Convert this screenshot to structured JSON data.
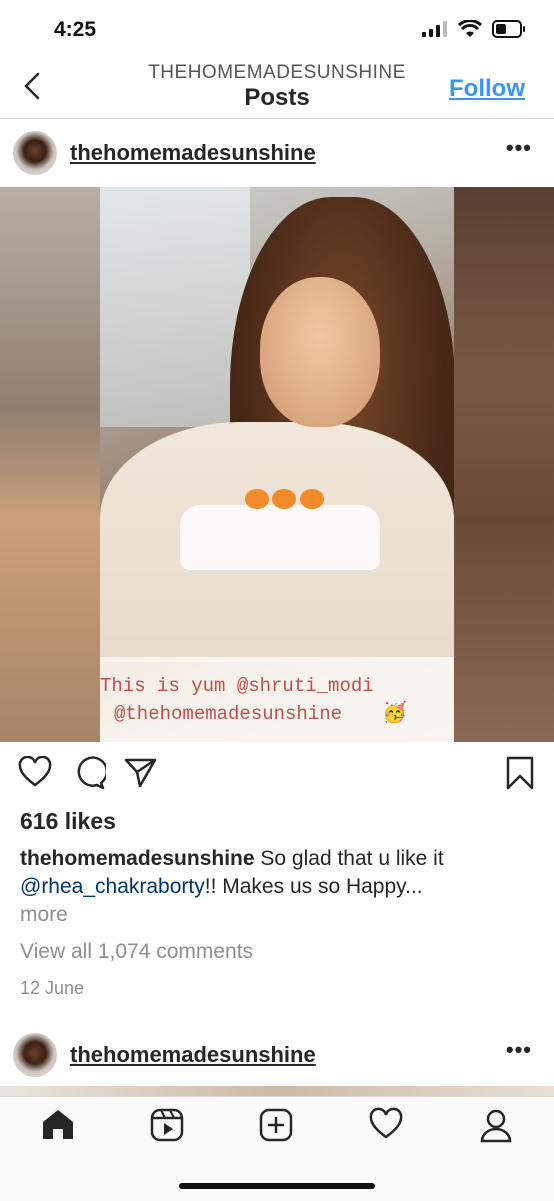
{
  "status": {
    "time": "4:25"
  },
  "header": {
    "subtitle": "THEHOMEMADESUNSHINE",
    "title": "Posts",
    "follow_label": "Follow"
  },
  "post": {
    "username": "thehomemadesunshine",
    "image_caption": {
      "line1": "This is yum @shruti_modi",
      "line2": "@thehomemadesunshine",
      "emoji": "🥳"
    },
    "likes": "616 likes",
    "caption": {
      "username": "thehomemadesunshine",
      "text_before": " So glad that u like it ",
      "mention": "@rhea_chakraborty",
      "text_after": "!! Makes us so Happy...",
      "more": "more"
    },
    "view_comments": "View all 1,074 comments",
    "date": "12 June"
  },
  "next_post": {
    "username": "thehomemadesunshine"
  },
  "tabs": [
    {
      "name": "home",
      "icon": "home-icon"
    },
    {
      "name": "reels",
      "icon": "reels-icon"
    },
    {
      "name": "create",
      "icon": "add-post-icon"
    },
    {
      "name": "activity",
      "icon": "heart-icon"
    },
    {
      "name": "profile",
      "icon": "profile-icon"
    }
  ]
}
